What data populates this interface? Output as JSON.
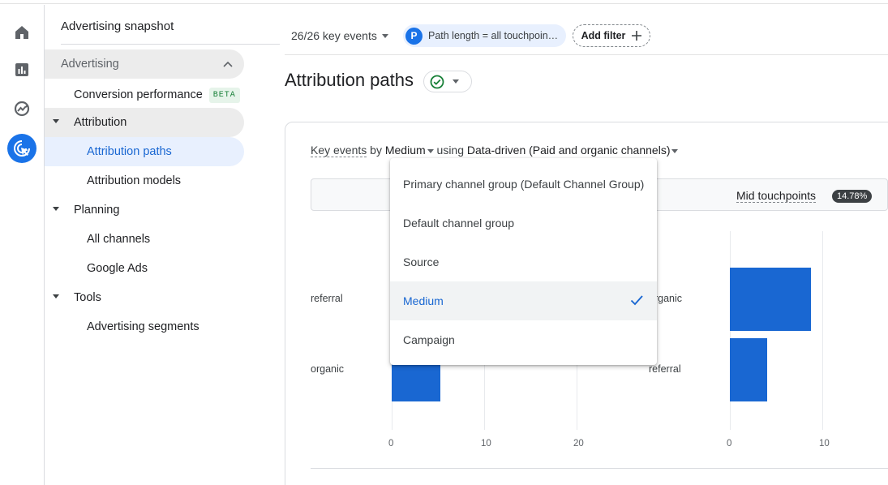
{
  "rail": {
    "items": [
      {
        "icon": "home-icon"
      },
      {
        "icon": "reports-icon"
      },
      {
        "icon": "explore-icon"
      },
      {
        "icon": "advertising-icon",
        "active": true
      }
    ],
    "accent": "#1a73e8"
  },
  "sidebar": {
    "snapshot": "Advertising snapshot",
    "section": "Advertising",
    "conversion_performance": "Conversion performance",
    "beta": "BETA",
    "attribution": "Attribution",
    "attribution_paths": "Attribution paths",
    "attribution_models": "Attribution models",
    "planning": "Planning",
    "all_channels": "All channels",
    "google_ads": "Google Ads",
    "tools": "Tools",
    "advertising_segments": "Advertising segments"
  },
  "toolbar": {
    "key_events": "26/26 key events",
    "filter_badge": "P",
    "filter_chip": "Path length = all touchpoin…",
    "add_filter": "Add filter"
  },
  "page": {
    "title": "Attribution paths"
  },
  "card": {
    "head_key_events": "Key events",
    "head_by": "by",
    "head_dimension": "Medium",
    "head_using": "using",
    "head_model": "Data-driven (Paid and organic channels)",
    "mid_touchpoints_label": "Mid touchpoints",
    "mid_touchpoints_pct": "14.78%"
  },
  "menu": {
    "options": [
      "Primary channel group (Default Channel Group)",
      "Default channel group",
      "Source",
      "Medium",
      "Campaign"
    ],
    "selected": "Medium"
  },
  "chart_data": [
    {
      "type": "bar",
      "orientation": "horizontal",
      "categories": [
        "referral",
        "organic"
      ],
      "values": [
        null,
        5.3
      ],
      "xticks": [
        "0",
        "10",
        "20"
      ],
      "xlim": [
        0,
        25
      ],
      "note_obscured_first_value": true
    },
    {
      "type": "bar",
      "orientation": "horizontal",
      "categories": [
        "organic",
        "referral"
      ],
      "values": [
        8.8,
        4.0
      ],
      "xticks": [
        "0",
        "10"
      ],
      "xlim": [
        0,
        17
      ]
    }
  ]
}
